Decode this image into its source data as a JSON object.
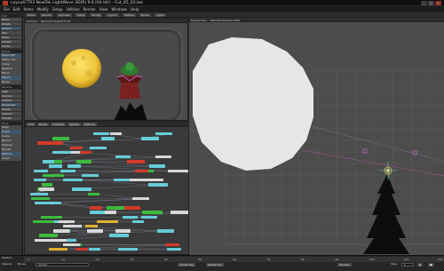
{
  "window": {
    "title": "LayoutCTR3 NewTek LightWave 3D(R) 9.6 [64 bit] – Cut_05_03.lws"
  },
  "menubar": {
    "items": [
      "File",
      "Edit",
      "Items",
      "Modify",
      "Setup",
      "Utilities",
      "Render",
      "View",
      "Windows",
      "Help"
    ]
  },
  "toolbar": {
    "items": [
      "Items",
      "Render",
      "Animate",
      "Setup",
      "Modify",
      "Layout",
      "Utilities",
      "Bones",
      "Lights"
    ]
  },
  "sidebar": {
    "buttons": [
      "Move",
      "Rotate",
      "Stretch",
      "Size",
      "Scale",
      "Squash",
      "Center",
      "Move TCB",
      "Motion Op",
      "Clone",
      "Replace",
      "Mirror",
      "Object",
      "Bones",
      "Light",
      "Camera",
      "Surface",
      "Properties",
      "Delete",
      "Generic",
      "Presets",
      "Dope",
      "Graph",
      "Scene",
      "Record",
      "Preview",
      "Render",
      "Options",
      "Cloud"
    ],
    "heads": [
      "Edit",
      "Modes",
      "Objects",
      "Tools"
    ]
  },
  "viewports": {
    "top_left": {
      "view": "Camera",
      "mode": "Textured Shaded Solid"
    },
    "right": {
      "view": "Perspective",
      "mode": "Textured Shaded Solid"
    }
  },
  "nodepanel": {
    "tabs": [
      "Edit",
      "Nodes",
      "Selected",
      "Update",
      "Options"
    ],
    "colors": {
      "green": "#3dbb3d",
      "cyan": "#66ccd8",
      "yellow": "#e0b030",
      "red": "#d23a2a",
      "white": "#d8d8d8"
    }
  },
  "timeline": {
    "ticks": [
      "0",
      "10",
      "20",
      "30",
      "40",
      "50",
      "60",
      "70",
      "80",
      "90",
      "100",
      "110",
      "120"
    ],
    "position_label": "Position",
    "rows": {
      "objects_label": "Objects",
      "bones_label": "Bones",
      "current_item": "(none)",
      "create_key": "Create Key",
      "delete_key": "Delete Key",
      "preview": "Preview",
      "step_label": "Step",
      "step_value": "1"
    }
  },
  "scene": {
    "moon_color": "#f0cd3a",
    "sky_grid_color": "#5f5f5f",
    "orb_color": "#e6e6e6"
  }
}
